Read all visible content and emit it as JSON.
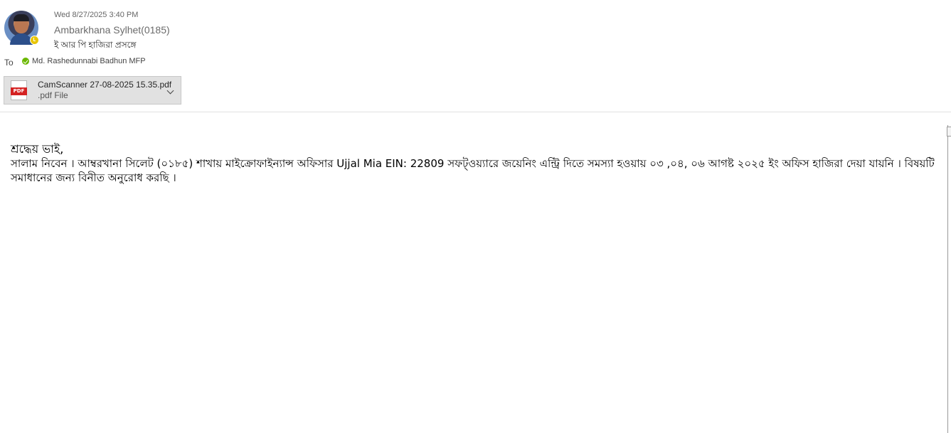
{
  "message": {
    "date": "Wed 8/27/2025 3:40 PM",
    "sender": "Ambarkhana Sylhet(0185)",
    "subject": "ই আর পি হাজিরা প্রসঙ্গে",
    "to_label": "To",
    "recipient": "Md. Rashedunnabi Badhun MFP"
  },
  "attachment": {
    "file_name": "CamScanner 27-08-2025 15.35.pdf",
    "file_type": ".pdf File",
    "icon_label": "PDF",
    "icon": "pdf-file-icon"
  },
  "body": {
    "greeting": "শ্রদ্ধেয় ভাই,",
    "paragraph": "সালাম নিবেন । আম্বরখানা সিলেট (০১৮৫) শাখায় মাইক্রোফাইন্যান্স অফিসার Ujjal Mia EIN: 22809 সফট্ওয়্যারে জয়েনিং এন্ট্রি দিতে সমস্যা হওয়ায় ০৩ ,০৪, ০৬ আগষ্ট ২০২৫ ইং অফিস হাজিরা দেয়া যায়নি । বিষয়টি সমাধানের জন্য বিনীত অনুরোধ করছি ।"
  },
  "colors": {
    "presence_away": "#e8c500",
    "verified_green": "#6bb700",
    "pdf_red": "#d42121"
  }
}
